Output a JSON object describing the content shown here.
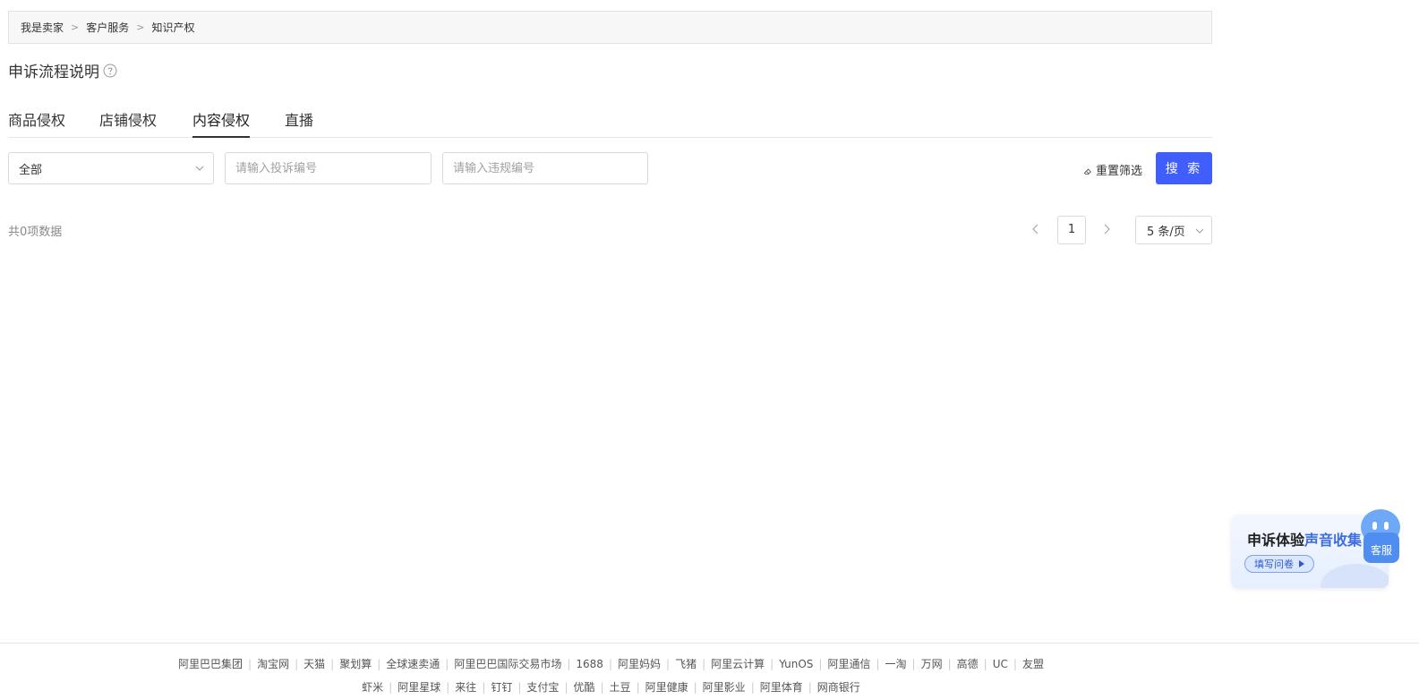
{
  "breadcrumb": {
    "items": [
      "我是卖家",
      "客户服务",
      "知识产权"
    ],
    "separator": ">"
  },
  "page": {
    "title": "申诉流程说明"
  },
  "tabs": [
    {
      "label": "商品侵权",
      "active": false
    },
    {
      "label": "店铺侵权",
      "active": false
    },
    {
      "label": "内容侵权",
      "active": true
    },
    {
      "label": "直播",
      "active": false
    }
  ],
  "filters": {
    "type_select": {
      "value": "全部"
    },
    "complaint_no": {
      "placeholder": "请输入投诉编号",
      "value": ""
    },
    "violation_no": {
      "placeholder": "请输入违规编号",
      "value": ""
    },
    "reset_label": "重置筛选",
    "search_label": "搜 索"
  },
  "results": {
    "total_text": "共0项数据"
  },
  "pagination": {
    "current_page": "1",
    "page_size": "5 条/页"
  },
  "survey": {
    "title_plain": "申诉体验",
    "title_highlight": "声音收集",
    "button_label": "填写问卷"
  },
  "customer_service": {
    "label": "客服"
  },
  "footer": {
    "row1": [
      "阿里巴巴集团",
      "淘宝网",
      "天猫",
      "聚划算",
      "全球速卖通",
      "阿里巴巴国际交易市场",
      "1688",
      "阿里妈妈",
      "飞猪",
      "阿里云计算",
      "YunOS",
      "阿里通信",
      "一淘",
      "万网",
      "高德",
      "UC",
      "友盟"
    ],
    "row2": [
      "虾米",
      "阿里星球",
      "来往",
      "钉钉",
      "支付宝",
      "优酷",
      "土豆",
      "阿里健康",
      "阿里影业",
      "阿里体育",
      "网商银行"
    ]
  },
  "colors": {
    "primary": "#3f5efb",
    "survey_highlight": "#3d6de0",
    "cs_blue": "#4f8ef0"
  }
}
